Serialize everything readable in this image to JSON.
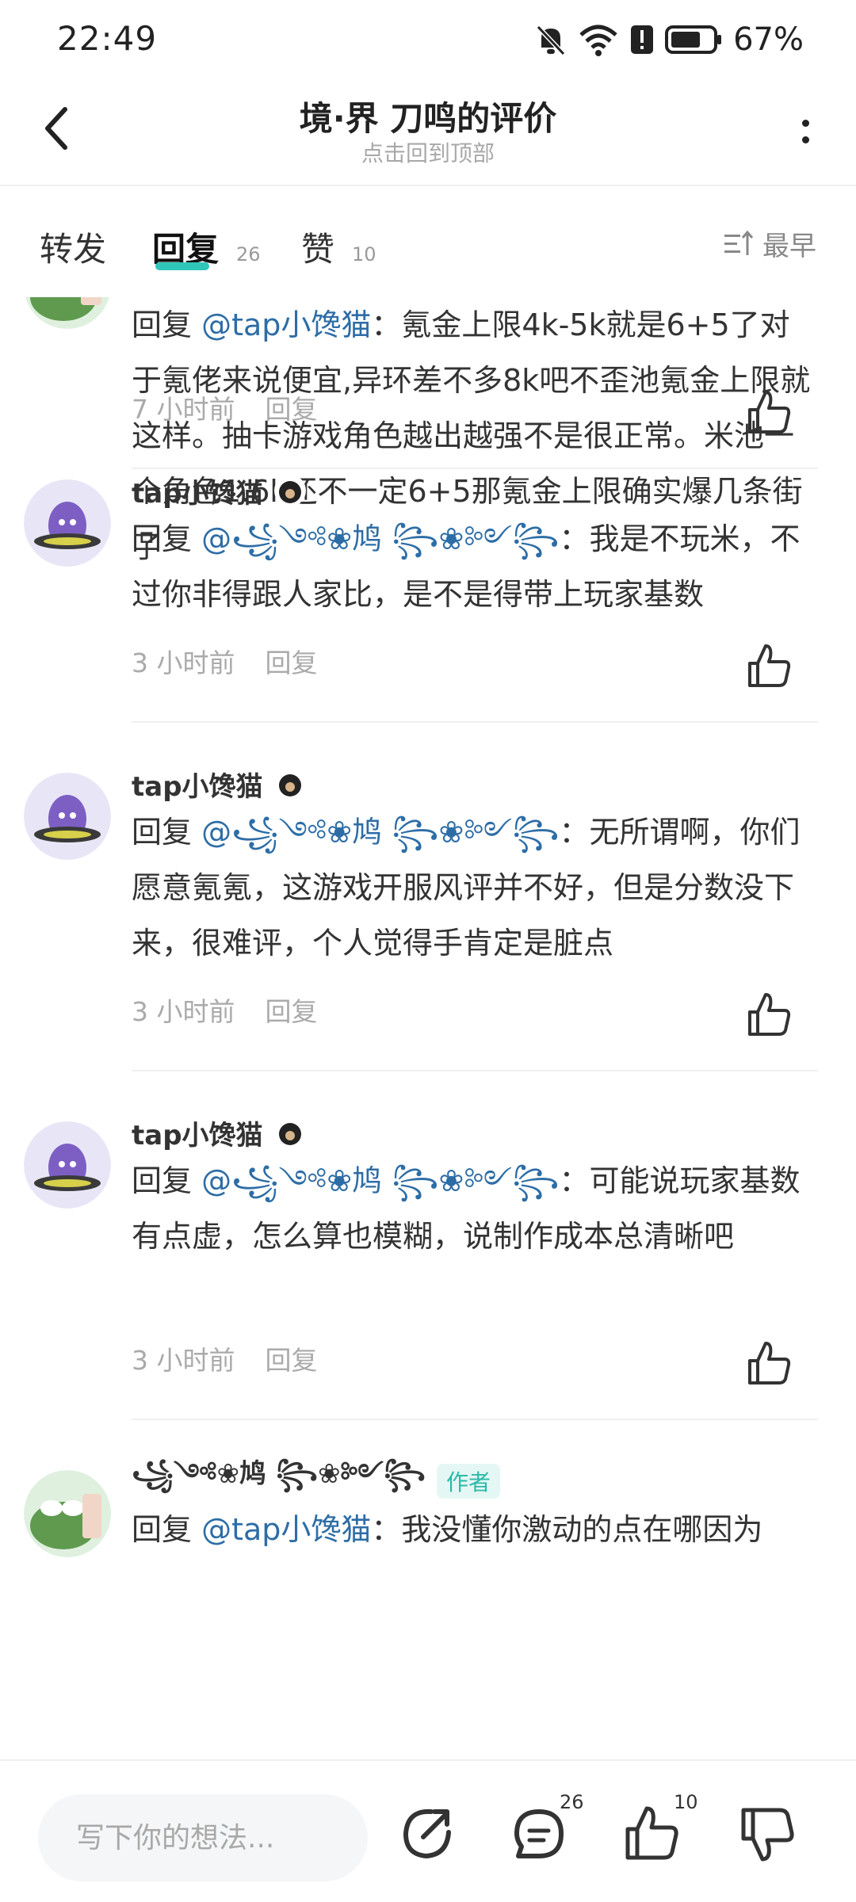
{
  "status_bar": {
    "time": "22:49",
    "battery": "67%"
  },
  "header": {
    "title": "境·界 刀鸣的评价",
    "subtitle": "点击回到顶部"
  },
  "tabs": [
    {
      "label": "转发",
      "count": ""
    },
    {
      "label": "回复",
      "count": "26"
    },
    {
      "label": "赞",
      "count": "10"
    }
  ],
  "sort": {
    "label": "最早"
  },
  "comments": [
    {
      "author": "",
      "reply_prefix": "回复 ",
      "mention": "@tap小馋猫",
      "text": "：氪金上限4k-5k就是6+5了对于氪佬来说便宜,异环差不多8k吧不歪池氪金上限就这样。抽卡游戏角色越出越强不是很正常。米池一个角色1.6k还不一定6+5那氪金上限确实爆几条街了",
      "time": "7 小时前",
      "reply_label": "回复"
    },
    {
      "author": "tap小馋猫",
      "reply_prefix": "回复 ",
      "mention": "@꧁༺❀鸠 ꧂❀༻꧂",
      "text": "：我是不玩米，不过你非得跟人家比，是不是得带上玩家基数",
      "time": "3 小时前",
      "reply_label": "回复"
    },
    {
      "author": "tap小馋猫",
      "reply_prefix": "回复 ",
      "mention": "@꧁༺❀鸠 ꧂❀༻꧂",
      "text": "：无所谓啊，你们愿意氪氪，这游戏开服风评并不好，但是分数没下来，很难评，个人觉得手肯定是脏点",
      "time": "3 小时前",
      "reply_label": "回复"
    },
    {
      "author": "tap小馋猫",
      "reply_prefix": "回复 ",
      "mention": "@꧁༺❀鸠 ꧂❀༻꧂",
      "text": "：可能说玩家基数有点虚，怎么算也模糊，说制作成本总清晰吧",
      "time": "3 小时前",
      "reply_label": "回复"
    },
    {
      "author": "꧁༺❀鸠 ꧂❀༻꧂",
      "author_tag": "作者",
      "reply_prefix": "回复 ",
      "mention": "@tap小馋猫",
      "text": "：我没懂你激动的点在哪因为"
    }
  ],
  "bottom_bar": {
    "input_placeholder": "写下你的想法...",
    "comment_count": "26",
    "like_count": "10"
  },
  "colors": {
    "accent": "#2fc6b9",
    "mention": "#2d6da6",
    "muted": "#aaaaaa"
  },
  "icons": [
    "back-icon",
    "more-icon",
    "sort-icon",
    "like-icon",
    "share-icon",
    "comment-icon",
    "dislike-icon"
  ]
}
